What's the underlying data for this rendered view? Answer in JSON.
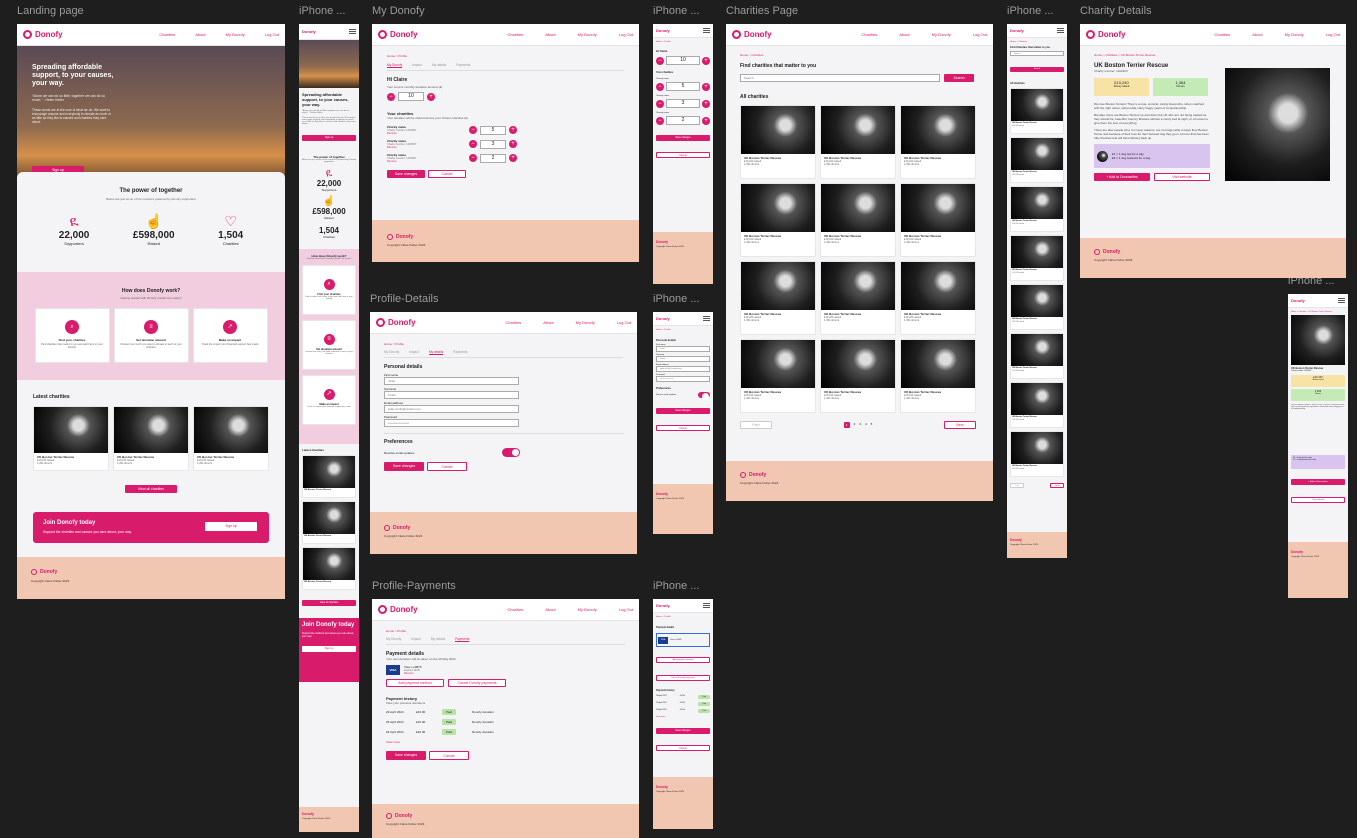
{
  "labels": {
    "landing": "Landing page",
    "iphone": "iPhone ...",
    "my_donofy": "My Donofy",
    "charities_page": "Charities Page",
    "charity_details": "Charity Details",
    "profile_details": "Profile-Details",
    "profile_payments": "Profile-Payments"
  },
  "brand": {
    "name": "Donofy",
    "accent": "#d81b6b",
    "footer_color": "#f1c7b2"
  },
  "nav": {
    "charities": "Charities",
    "about": "About",
    "my_donofy": "My Donofy",
    "logout": "Log Out"
  },
  "landing": {
    "hero_title": "Spreading affordable support, to your causes, your way.",
    "hero_quote": "\"Alone we can do so little; together we can do so much.\" - Helen Keller",
    "hero_body": "These words are at the core of what we do. We want to encourage anyone and everybody to donate as much or as little as they like to causes and charities they care about.",
    "signup": "Sign up",
    "power_title": "The power of together",
    "power_sub": "Below are just some of the numbers powered by Donofy supporters",
    "stats": [
      {
        "value": "22,000",
        "label": "Supporters",
        "icon": "people-icon"
      },
      {
        "value": "£598,000",
        "label": "Raised",
        "icon": "hand-coin-icon"
      },
      {
        "value": "1,504",
        "label": "Charities",
        "icon": "heart-icon"
      }
    ],
    "how_title": "How does Donofy work?",
    "how_sub": "Getting started with Donofy couldn't be easier!",
    "steps": [
      {
        "title": "Find your charities",
        "text": "Find charities that matter to you and add them to your Donofy",
        "icon": "search-icon"
      },
      {
        "title": "Set donation amount",
        "text": "Choose how much you want to donate to each of your charities",
        "icon": "sliders-icon"
      },
      {
        "title": "Make an impact",
        "text": "Track the impact your financial support has made",
        "icon": "chart-icon"
      }
    ],
    "latest_title": "Latest charities",
    "charity_name": "UK Boston Terrier Rescue",
    "charity_raised": "£10,240 raised",
    "charity_donors": "1,394 donors",
    "view_all": "View all charities",
    "join_title": "Join Donofy today",
    "join_sub": "Support the charities and causes you care about, your way.",
    "copyright": "Copyright Claire Fisher 2023."
  },
  "my_donofy": {
    "breadcrumb": "Home  >  Profile",
    "tabs": [
      "My Donofy",
      "Impact",
      "My details",
      "Payments"
    ],
    "greeting": "Hi Claire",
    "monthly_label": "Your current monthly donation amount (£)",
    "monthly_value": "10",
    "your_charities": "Your charities",
    "split_note": "Your donation will be shared across your chosen charities (£)",
    "charities": [
      {
        "name": "Charity name",
        "number": "Charity number: 1234567",
        "remove": "Remove",
        "amount": "5"
      },
      {
        "name": "Charity name",
        "number": "Charity number: 1234567",
        "remove": "Remove",
        "amount": "3"
      },
      {
        "name": "Charity name",
        "number": "Charity number: 1234567",
        "remove": "Remove",
        "amount": "2"
      }
    ],
    "save": "Save changes",
    "cancel": "Cancel"
  },
  "profile_details": {
    "section": "Personal details",
    "first_name_label": "First name",
    "first_name": "Jodie",
    "surname_label": "Surname",
    "surname": "Smith",
    "email_label": "Email address",
    "email": "jodie.smith@random.net",
    "password_label": "Password",
    "password": "••••••••••••••••••••",
    "prefs": "Preferences",
    "email_updates": "Receive email updates"
  },
  "profile_payments": {
    "section": "Payment details",
    "next_payment": "Your next donation will be taken on the 29 May 2024",
    "card": "Visa ••••9876",
    "expires": "Expires 12/25",
    "remove": "Remove",
    "add_method": "Add payment method",
    "cancel_payments": "Cancel Donofy payments",
    "history_title": "Payment history",
    "history_sub": "View your previous donations",
    "history": [
      {
        "date": "29 April 2024",
        "amount": "£10.00",
        "status": "Paid",
        "type": "Donofy donation"
      },
      {
        "date": "29 April 2024",
        "amount": "£10.00",
        "status": "Paid",
        "type": "Donofy donation"
      },
      {
        "date": "29 April 2024",
        "amount": "£20.00",
        "status": "Paid",
        "type": "Donofy donation"
      }
    ],
    "view_more": "View more"
  },
  "charities_page": {
    "breadcrumb": "Home  >  Charities",
    "find_title": "Find charities that matter to you",
    "search_placeholder": "Search",
    "search_btn": "Search",
    "all_title": "All charities",
    "prev": "Prev",
    "next": "Next",
    "pages": [
      "1",
      "2",
      "3",
      "4",
      "5"
    ]
  },
  "charity_details": {
    "breadcrumb": "Home  >  Charities  >  UK Boston Terrier Rescue",
    "title": "UK Boston Terrier Rescue",
    "number": "Charity number: 1162403",
    "raised_value": "£10,240",
    "raised_label": "Money raised",
    "donors_value": "1,364",
    "donors_label": "Donors",
    "para1": "We love Boston Terriers! They're a cute, comical, caring breed who, when matched with the right owner, will provide many happy years of companionship.",
    "para2": "But alas, there are Boston Terriers up and down the UK who are not being treated as they should be; beautiful, bouncy Bostons without a comfy bed at night, or a human to give them the love of everything.",
    "para3": "There are also people who, for many reasons, are no longer able to keep their Boston Terrier and because of their love for their beloved dog they go to a home that has been fully checked and will have lifelong back up.",
    "impact1": "£1 = 1 dog fed for a day",
    "impact2": "£5 = 1 dog fostered for a day",
    "add_btn": "+ Add to Donoanfies",
    "visit_btn": "Visit website"
  },
  "mobile": {
    "iphone_charities_find": "Find Charities that matter to you",
    "search": "Search",
    "all": "All charities",
    "prev": "Prev",
    "next": "Next",
    "add_btn": "+ Add to Donoanfies",
    "visit_btn": "Visit website",
    "join_title": "Join Donofy today"
  }
}
